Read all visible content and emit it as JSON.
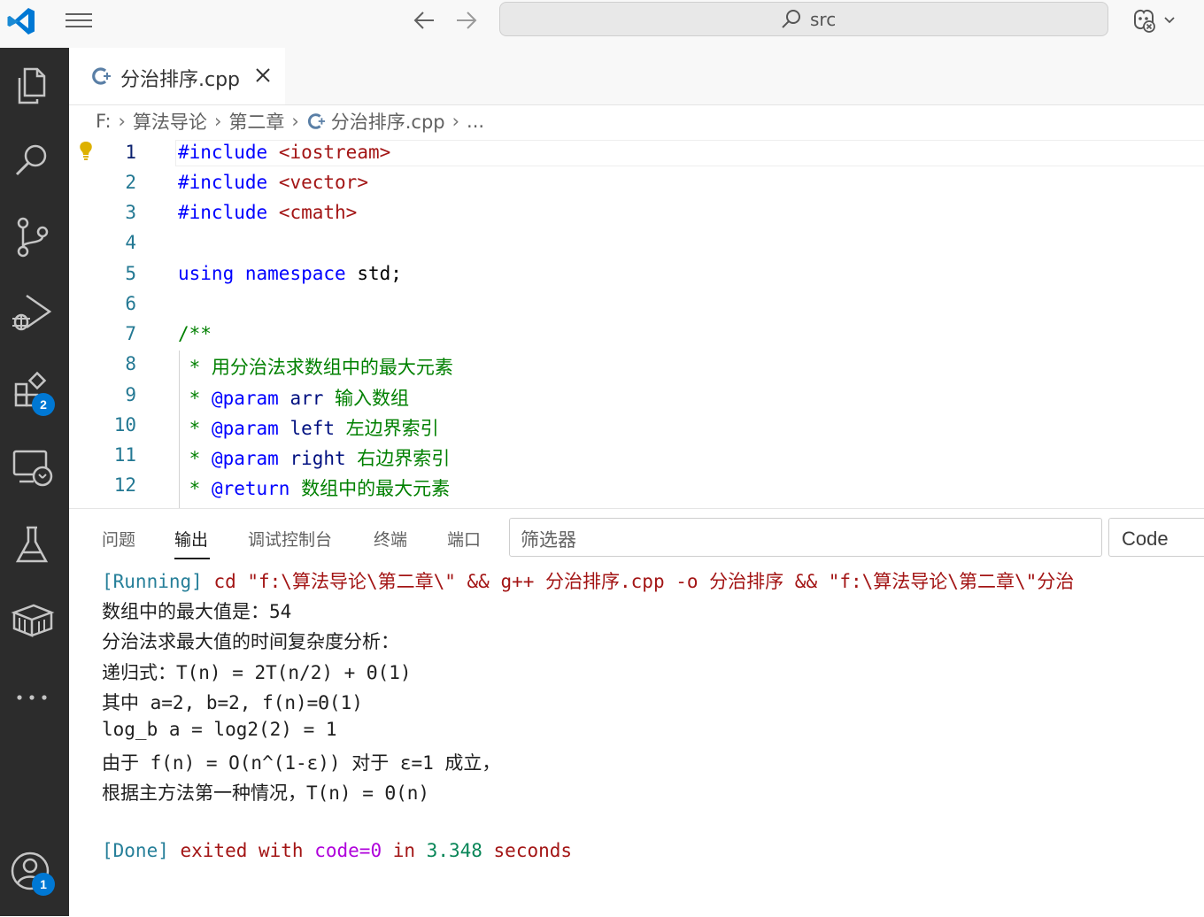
{
  "titlebar": {
    "app_icon": "vscode-logo-icon",
    "menu_icon": "hamburger-menu-icon",
    "back_icon": "arrow-left-icon",
    "forward_icon": "arrow-right-icon",
    "search_icon": "search-icon",
    "search_text": "src",
    "copilot_icon": "copilot-icon"
  },
  "activity_bar": {
    "items": [
      {
        "name": "explorer-icon"
      },
      {
        "name": "search-icon"
      },
      {
        "name": "source-control-icon"
      },
      {
        "name": "run-debug-icon"
      },
      {
        "name": "extensions-icon",
        "badge": "2"
      },
      {
        "name": "remote-explorer-icon"
      },
      {
        "name": "testing-icon"
      },
      {
        "name": "containers-icon"
      },
      {
        "name": "more-icon"
      }
    ],
    "accounts": {
      "name": "accounts-icon",
      "badge": "1"
    },
    "badge_color": "#0078d4"
  },
  "editor_tab": {
    "label": "分治排序.cpp",
    "close_icon": "close-icon"
  },
  "breadcrumb": {
    "items": [
      "F:",
      "算法导论",
      "第二章",
      "分治排序.cpp",
      "..."
    ]
  },
  "editor": {
    "line_numbers": [
      "1",
      "2",
      "3",
      "4",
      "5",
      "6",
      "7",
      "8",
      "9",
      "10",
      "11",
      "12"
    ],
    "active_line": "1",
    "lines": {
      "l1": {
        "a": "#include",
        "b": " ",
        "c": "<iostream>"
      },
      "l2": {
        "a": "#include",
        "b": " ",
        "c": "<vector>"
      },
      "l3": {
        "a": "#include",
        "b": " ",
        "c": "<cmath>"
      },
      "l5": {
        "a": "using",
        "b": " ",
        "c": "namespace",
        "d": " std;"
      },
      "l7": {
        "a": "/**"
      },
      "l8": {
        "a": " * 用分治法求数组中的最大元素"
      },
      "l9": {
        "a": " * ",
        "b": "@param",
        "c": " arr",
        "d": " 输入数组"
      },
      "l10": {
        "a": " * ",
        "b": "@param",
        "c": " left",
        "d": " 左边界索引"
      },
      "l11": {
        "a": " * ",
        "b": "@param",
        "c": " right",
        "d": " 右边界索引"
      },
      "l12": {
        "a": " * ",
        "b": "@return",
        "c": " 数组中的最大元素"
      }
    }
  },
  "panel": {
    "tabs": [
      "问题",
      "输出",
      "调试控制台",
      "终端",
      "端口"
    ],
    "active_tab": "输出",
    "filter_placeholder": "筛选器",
    "channel_select": "Code",
    "output": {
      "run_tag": "[Running]",
      "run_cmd": " cd \"f:\\算法导论\\第二章\\\" && g++ 分治排序.cpp -o 分治排序 && \"f:\\算法导论\\第二章\\\"分治",
      "lines": [
        "数组中的最大值是：54",
        "分治法求最大值的时间复杂度分析：",
        "递归式：T(n) = 2T(n/2) + Θ(1)",
        "其中 a=2, b=2, f(n)=Θ(1)",
        "log_b a = log2(2) = 1",
        "由于 f(n) = O(n^(1-ε)) 对于 ε=1 成立，",
        "根据主方法第一种情况，T(n) = Θ(n)"
      ],
      "done_tag": "[Done]",
      "done_text1": " exited with ",
      "done_text2": "code=0",
      "done_text3": " in ",
      "done_text4": "3.348",
      "done_text5": " seconds"
    }
  }
}
